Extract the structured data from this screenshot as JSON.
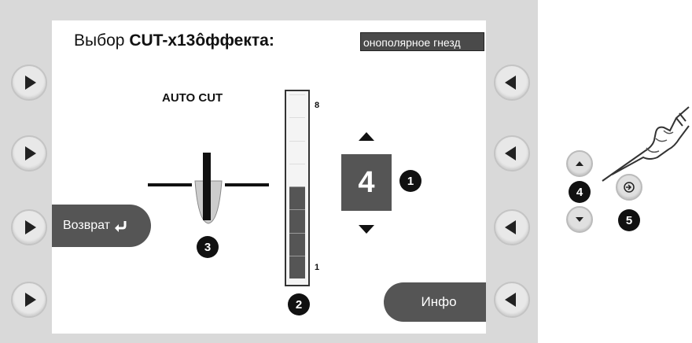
{
  "screen": {
    "title_prefix": "Выбор ",
    "title_bold": "CUT-x13ôффекта:",
    "socket_label": "онополярное гнезд",
    "mode_label": "AUTO CUT",
    "effect_value": "4",
    "bar": {
      "min_label": "1",
      "max_label": "8",
      "level": 4,
      "segments": 8
    },
    "return_label": "Возврат",
    "info_label": "Инфо"
  },
  "callouts": {
    "value": "1",
    "bar": "2",
    "electrode": "3",
    "updown": "4",
    "enter": "5"
  },
  "icons": {
    "left_buttons": "play-right-icon",
    "right_buttons": "play-left-icon",
    "return": "return-arrow-icon",
    "enter": "enter-icon",
    "hand": "pointing-hand-icon"
  },
  "colors": {
    "bezel": "#d9d9d9",
    "dark_fill": "#555555"
  }
}
